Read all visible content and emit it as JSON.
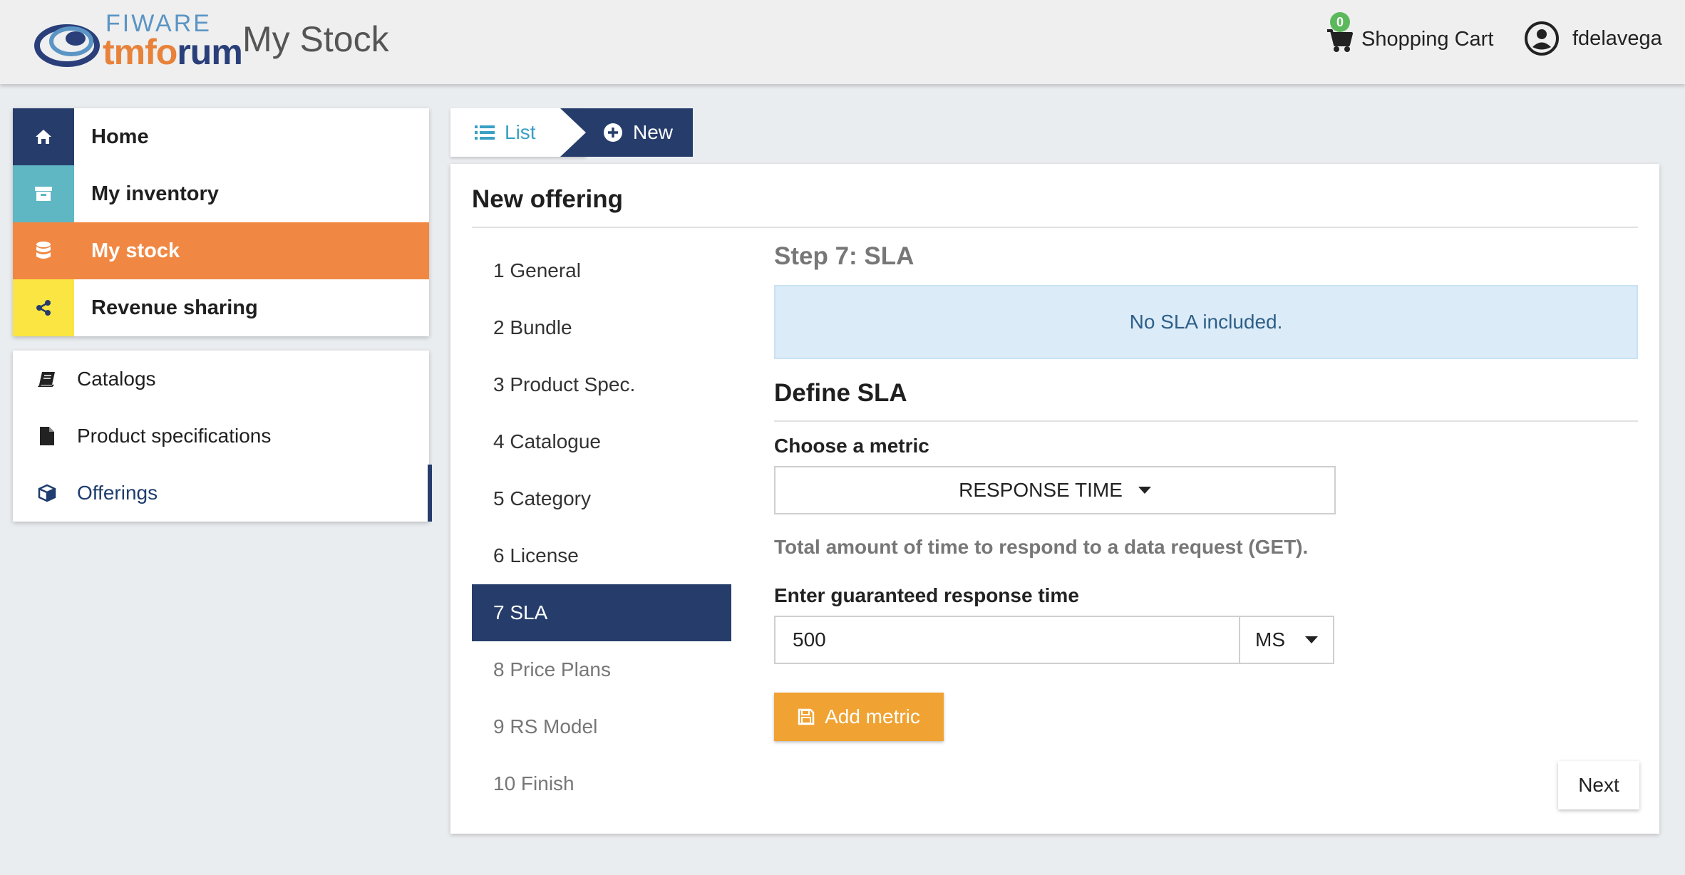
{
  "header": {
    "logo_top": "FIWARE",
    "logo_bottom_a": "tmf",
    "logo_bottom_b": "rum",
    "title": "My Stock",
    "cart_count": "0",
    "cart_label": "Shopping Cart",
    "user_name": "fdelavega"
  },
  "menu_primary": [
    {
      "label": "Home",
      "icon": "home-icon"
    },
    {
      "label": "My inventory",
      "icon": "archive-icon"
    },
    {
      "label": "My stock",
      "icon": "database-icon"
    },
    {
      "label": "Revenue sharing",
      "icon": "share-icon"
    }
  ],
  "menu_secondary": [
    {
      "label": "Catalogs",
      "icon": "book-icon"
    },
    {
      "label": "Product specifications",
      "icon": "file-icon"
    },
    {
      "label": "Offerings",
      "icon": "cube-icon"
    }
  ],
  "crumbs": {
    "list_label": "List",
    "new_label": "New"
  },
  "panel": {
    "title": "New offering",
    "steps": [
      "1 General",
      "2 Bundle",
      "3 Product Spec.",
      "4 Catalogue",
      "5 Category",
      "6 License",
      "7 SLA",
      "8 Price Plans",
      "9 RS Model",
      "10 Finish"
    ],
    "active_step": 7,
    "step_title": "Step 7: SLA",
    "alert": "No SLA included.",
    "define_title": "Define SLA",
    "metric_label": "Choose a metric",
    "metric_value": "RESPONSE TIME",
    "metric_description": "Total amount of time to respond to a data request (GET).",
    "response_label": "Enter guaranteed response time",
    "response_value": "500",
    "unit_value": "MS",
    "add_button": "Add metric",
    "next_button": "Next"
  },
  "colors": {
    "navy": "#263d6b",
    "teal": "#5fb7c4",
    "orange": "#f08843",
    "yellow": "#fbe543",
    "add_button": "#f0a232",
    "alert_bg": "#dbecf8",
    "link_blue": "#3aa0c4",
    "badge_green": "#5cb85c"
  }
}
